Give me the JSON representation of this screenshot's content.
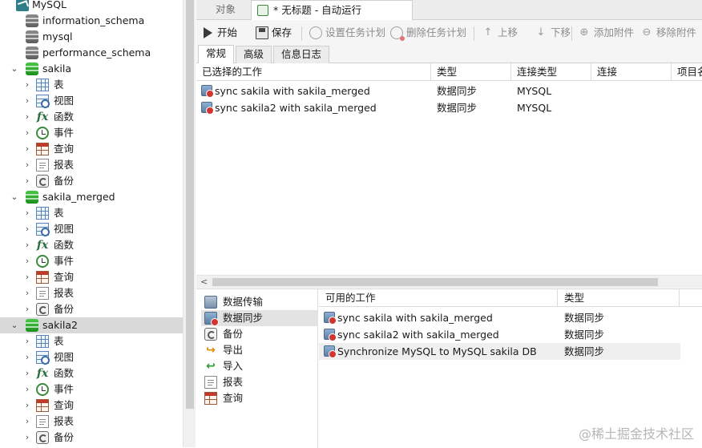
{
  "tree": {
    "root": {
      "label": "MySQL"
    },
    "system_dbs": [
      "information_schema",
      "mysql",
      "performance_schema"
    ],
    "databases": [
      {
        "label": "sakila",
        "items": [
          "表",
          "视图",
          "函数",
          "事件",
          "查询",
          "报表",
          "备份"
        ]
      },
      {
        "label": "sakila_merged",
        "items": [
          "表",
          "视图",
          "函数",
          "事件",
          "查询",
          "报表",
          "备份"
        ]
      },
      {
        "label": "sakila2",
        "items": [
          "表",
          "视图",
          "函数",
          "事件",
          "查询",
          "报表",
          "备份"
        ]
      }
    ]
  },
  "tabs": {
    "objects": "对象",
    "current": "* 无标题 - 自动运行"
  },
  "toolbar": {
    "start": "开始",
    "save": "保存",
    "set_schedule": "设置任务计划",
    "delete_schedule": "删除任务计划",
    "move_up": "上移",
    "move_down": "下移",
    "add_attachment": "添加附件",
    "remove_attachment": "移除附件"
  },
  "subtabs": {
    "general": "常规",
    "advanced": "高级",
    "log": "信息日志"
  },
  "selected_jobs": {
    "columns": [
      "已选择的工作",
      "类型",
      "连接类型",
      "连接",
      "项目名"
    ],
    "rows": [
      {
        "name": "sync sakila with sakila_merged",
        "type": "数据同步",
        "conn_type": "MYSQL"
      },
      {
        "name": "sync sakila2 with sakila_merged",
        "type": "数据同步",
        "conn_type": "MYSQL"
      }
    ]
  },
  "job_types": [
    "数据传输",
    "数据同步",
    "备份",
    "导出",
    "导入",
    "报表",
    "查询"
  ],
  "available_jobs": {
    "columns": [
      "可用的工作",
      "类型"
    ],
    "rows": [
      {
        "name": "sync sakila with sakila_merged",
        "type": "数据同步"
      },
      {
        "name": "sync sakila2 with sakila_merged",
        "type": "数据同步"
      },
      {
        "name": "Synchronize MySQL to MySQL sakila DB",
        "type": "数据同步"
      }
    ]
  },
  "watermark": "@稀土掘金技术社区",
  "colors": {
    "selection": "#d9d9d9",
    "db_green": "#2eaa2e",
    "panel_bg": "#f5f5f5"
  }
}
